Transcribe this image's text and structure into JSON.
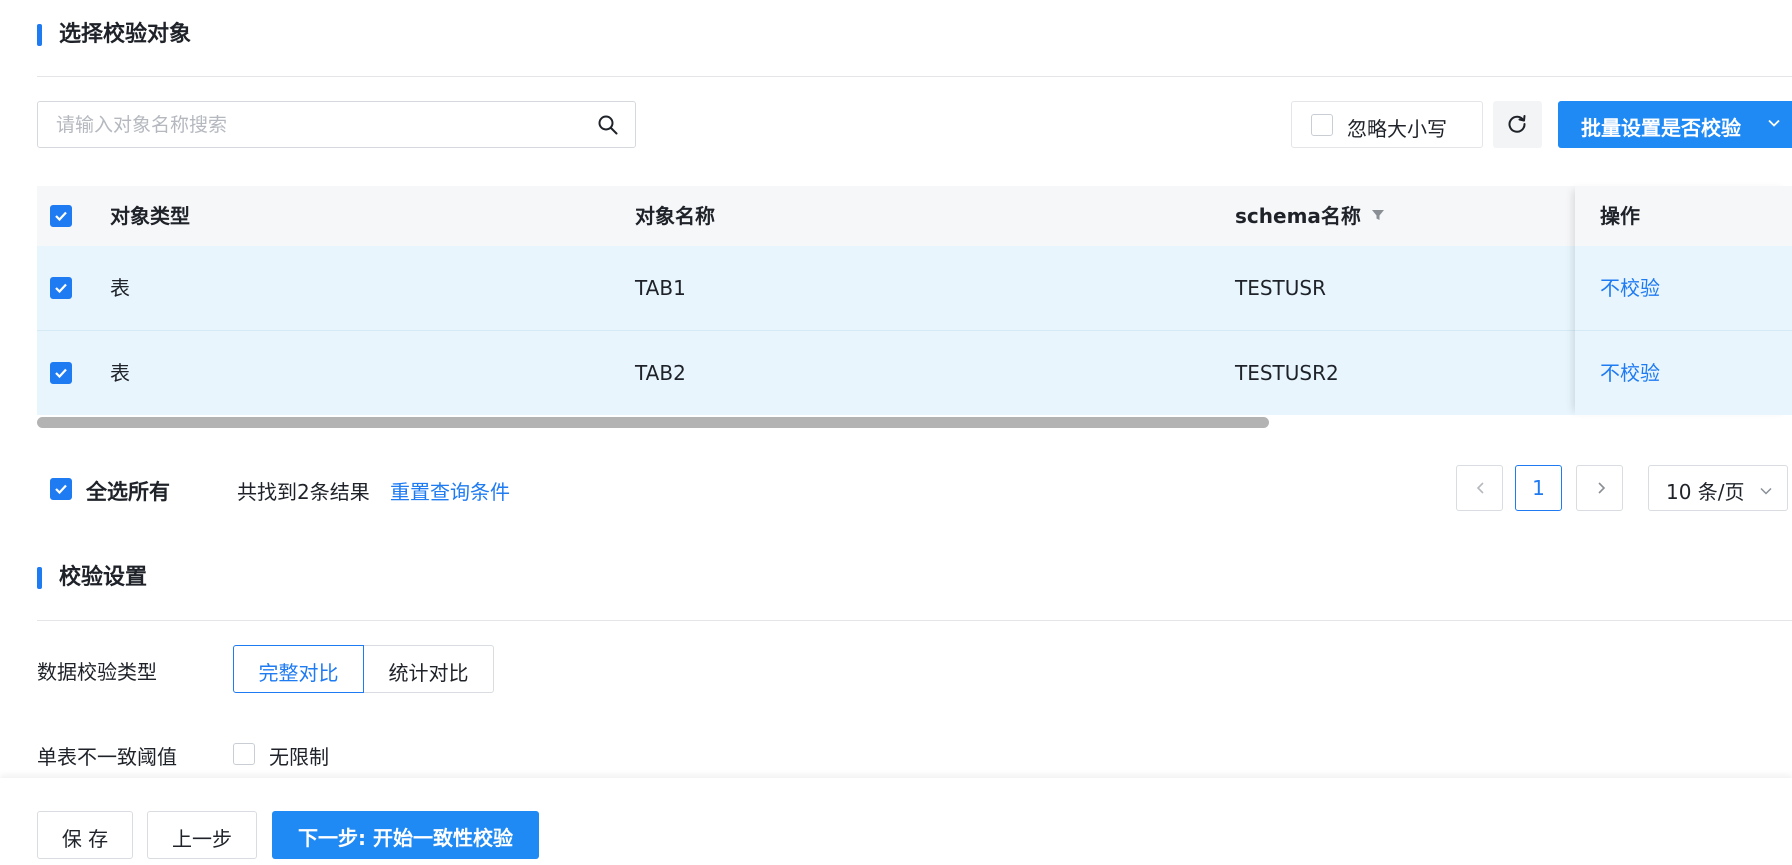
{
  "object_section": {
    "title": "选择校验对象"
  },
  "toolbar": {
    "search_placeholder": "请输入对象名称搜索",
    "search_value": "",
    "ignore_case_label": "忽略大小写",
    "ignore_case_checked": false,
    "batch_button_label": "批量设置是否校验"
  },
  "table": {
    "columns": [
      "对象类型",
      "对象名称",
      "schema名称",
      "操作"
    ],
    "header_checked": true,
    "rows": [
      {
        "checked": true,
        "type": "表",
        "name": "TAB1",
        "schema": "TESTUSR",
        "action": "不校验"
      },
      {
        "checked": true,
        "type": "表",
        "name": "TAB2",
        "schema": "TESTUSR2",
        "action": "不校验"
      }
    ]
  },
  "table_footer": {
    "select_all_label": "全选所有",
    "select_all_checked": true,
    "result_text": "共找到2条结果",
    "reset_label": "重置查询条件"
  },
  "pagination": {
    "current_page": "1",
    "page_size_label": "10 条/页"
  },
  "settings_section": {
    "title": "校验设置",
    "check_type_label": "数据校验类型",
    "check_type_options": [
      "完整对比",
      "统计对比"
    ],
    "check_type_selected": "完整对比",
    "threshold_label": "单表不一致阈值",
    "no_limit_label": "无限制",
    "no_limit_checked": false
  },
  "footer": {
    "save_label": "保 存",
    "prev_label": "上一步",
    "next_label": "下一步: 开始一致性校验"
  },
  "colors": {
    "primary": "#1f8af4",
    "link": "#1f7bf2",
    "row_highlight": "#e8f5fd"
  }
}
